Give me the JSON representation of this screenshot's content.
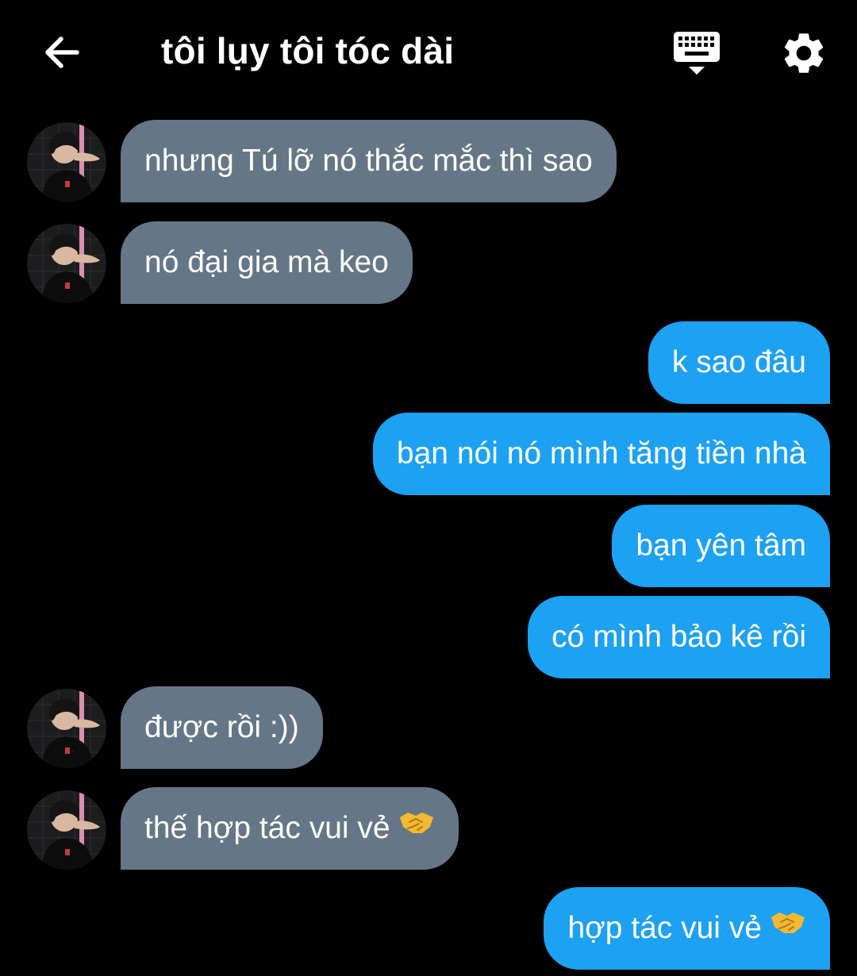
{
  "header": {
    "title": "tôi lụy tôi tóc dài",
    "back_icon": "arrow-left-icon",
    "keyboard_icon": "keyboard-icon",
    "settings_icon": "gear-icon"
  },
  "colors": {
    "background": "#000000",
    "incoming_bubble": "#657786",
    "outgoing_bubble": "#1da1f2",
    "text": "#ffffff"
  },
  "messages": [
    {
      "direction": "incoming",
      "text": "nhưng Tú lỡ nó thắc mắc thì sao"
    },
    {
      "direction": "incoming",
      "text": "nó đại gia mà keo"
    },
    {
      "direction": "outgoing",
      "text": "k sao đâu"
    },
    {
      "direction": "outgoing",
      "text": "bạn nói nó mình tăng tiền nhà"
    },
    {
      "direction": "outgoing",
      "text": "bạn yên tâm"
    },
    {
      "direction": "outgoing",
      "text": "có mình bảo kê rồi"
    },
    {
      "direction": "incoming",
      "text": "được rồi :))"
    },
    {
      "direction": "incoming",
      "text": "thế hợp tác vui vẻ",
      "emoji": "handshake-emoji"
    },
    {
      "direction": "outgoing",
      "text": "hợp tác vui vẻ",
      "emoji": "handshake-emoji"
    }
  ]
}
